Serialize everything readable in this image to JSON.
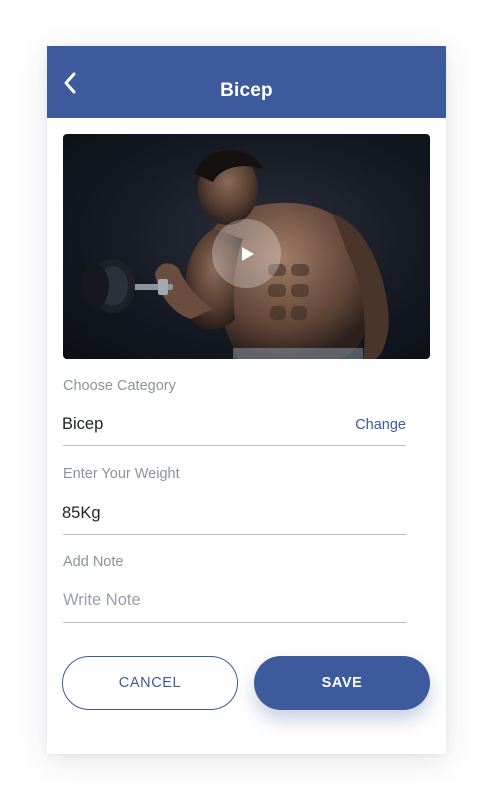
{
  "header": {
    "title": "Bicep",
    "back_icon": "chevron-left-icon"
  },
  "video": {
    "play_icon": "play-icon"
  },
  "category": {
    "label": "Choose Category",
    "value": "Bicep",
    "change_label": "Change"
  },
  "weight": {
    "label": "Enter Your Weight",
    "value": "85Kg"
  },
  "note": {
    "label": "Add Note",
    "placeholder": "Write Note"
  },
  "actions": {
    "cancel_label": "CANCEL",
    "save_label": "SAVE"
  },
  "colors": {
    "primary": "#3d5a9c",
    "label_gray": "#8a949e"
  }
}
